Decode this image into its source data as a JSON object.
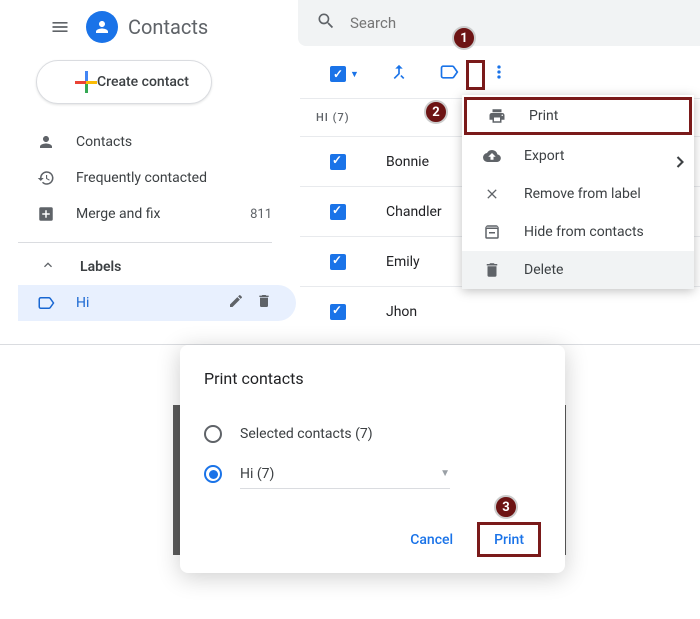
{
  "header": {
    "app_title": "Contacts",
    "search_placeholder": "Search"
  },
  "sidebar": {
    "create_label": "Create contact",
    "items": [
      {
        "label": "Contacts"
      },
      {
        "label": "Frequently contacted"
      },
      {
        "label": "Merge and fix",
        "count": "811"
      }
    ],
    "labels_header": "Labels",
    "label": {
      "name": "Hi"
    }
  },
  "list": {
    "group_header": "HI (7)",
    "contacts": [
      "Bonnie",
      "Chandler",
      "Emily",
      "Jhon"
    ]
  },
  "menu": {
    "print": "Print",
    "export": "Export",
    "remove": "Remove from label",
    "hide": "Hide from contacts",
    "delete": "Delete"
  },
  "steps": {
    "one": "1",
    "two": "2",
    "three": "3"
  },
  "dialog": {
    "title": "Print contacts",
    "opt_selected": "Selected contacts (7)",
    "opt_label": "Hi (7)",
    "cancel": "Cancel",
    "print": "Print"
  }
}
